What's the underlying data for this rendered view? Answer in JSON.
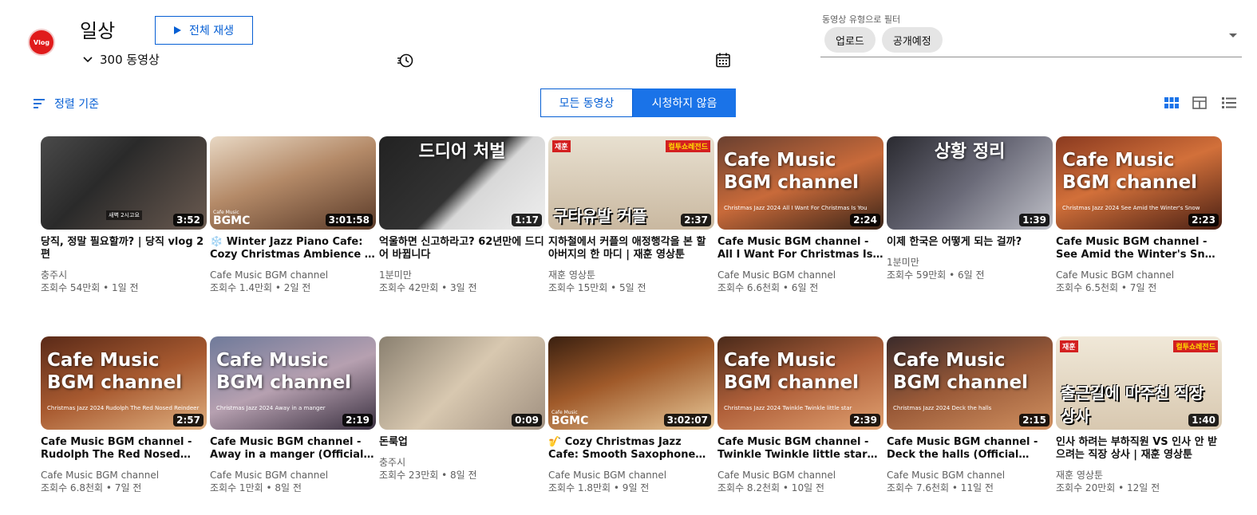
{
  "header": {
    "avatar_text": "Vlog",
    "title": "일상",
    "play_all_label": "전체 재생",
    "video_count": "300 동영상"
  },
  "filter": {
    "label": "동영상 유형으로 필터",
    "chips": [
      "업로드",
      "공개예정"
    ]
  },
  "controls": {
    "sort_label": "정렬 기준",
    "toggle_all": "모든 동영상",
    "toggle_unwatched": "시청하지 않음"
  },
  "colors": {
    "accent": "#065fd4",
    "toggle_active": "#1a73e8",
    "avatar": "#e01b1b"
  },
  "videos": [
    {
      "title": "당직, 정말 필요할까? | 당직 vlog 2편",
      "channel": "충주시",
      "meta": "조회수 54만회 • 1일 전",
      "duration": "3:52",
      "thumb": {
        "caption": "",
        "tag": "새벽 2시고요"
      }
    },
    {
      "title": "❄️ Winter Jazz Piano Cafe: Cozy Christmas Ambience | Smooth Jazz Music",
      "channel": "Cafe Music BGM channel",
      "meta": "조회수 1.4만회 • 2일 전",
      "duration": "3:01:58",
      "thumb": {
        "logo": "BGMC",
        "logo_small": "Cafe Music"
      }
    },
    {
      "title": "억울하면 신고하라고? 62년만에 드디어 바뀝니다",
      "channel": "1분미만",
      "meta": "조회수 42만회 • 3일 전",
      "duration": "1:17",
      "thumb": {
        "caption": "드디어 처벌"
      }
    },
    {
      "title": "지하철에서 커플의 애정행각을 본 할아버지의 한 마디 | 재훈 영상툰",
      "channel": "재훈 영상툰",
      "meta": "조회수 15만회 • 5일 전",
      "duration": "2:37",
      "thumb": {
        "bottom": "구타유발 커플",
        "badge_l": "재훈",
        "badge_r": "컬투쇼레전드"
      }
    },
    {
      "title": "Cafe Music BGM channel - All I Want For Christmas Is You (Official Music Video)",
      "channel": "Cafe Music BGM channel",
      "meta": "조회수 6.6천회 • 6일 전",
      "duration": "2:24",
      "thumb": {
        "caption": "Cafe Music\nBGM channel",
        "sub": "Christmas Jazz 2024  All I Want For Christmas Is You"
      }
    },
    {
      "title": "이제 한국은 어떻게 되는 걸까?",
      "channel": "1분미만",
      "meta": "조회수 59만회 • 6일 전",
      "duration": "1:39",
      "thumb": {
        "caption": "상황 정리"
      }
    },
    {
      "title": "Cafe Music BGM channel - See Amid the Winter's Snow (Official Music Video)",
      "channel": "Cafe Music BGM channel",
      "meta": "조회수 6.5천회 • 7일 전",
      "duration": "2:23",
      "thumb": {
        "caption": "Cafe Music\nBGM channel",
        "sub": "Christmas Jazz 2024  See Amid the Winter's Snow"
      }
    },
    {
      "title": "Cafe Music BGM channel - Rudolph The Red Nosed Reindeer (Official Music Video)",
      "channel": "Cafe Music BGM channel",
      "meta": "조회수 6.8천회 • 7일 전",
      "duration": "2:57",
      "thumb": {
        "caption": "Cafe Music\nBGM channel",
        "sub": "Christmas Jazz 2024  Rudolph The Red Nosed Reindeer"
      }
    },
    {
      "title": "Cafe Music BGM channel - Away in a manger (Official Music Video)",
      "channel": "Cafe Music BGM channel",
      "meta": "조회수 1만회 • 8일 전",
      "duration": "2:19",
      "thumb": {
        "caption": "Cafe Music\nBGM channel",
        "sub": "Christmas Jazz 2024  Away in a manger"
      }
    },
    {
      "title": "돈룩업",
      "channel": "충주시",
      "meta": "조회수 23만회 • 8일 전",
      "duration": "0:09",
      "thumb": {}
    },
    {
      "title": "🎷 Cozy Christmas Jazz Cafe: Smooth Saxophone Music",
      "channel": "Cafe Music BGM channel",
      "meta": "조회수 1.8만회 • 9일 전",
      "duration": "3:02:07",
      "thumb": {
        "logo": "BGMC",
        "logo_small": "Cafe Music"
      }
    },
    {
      "title": "Cafe Music BGM channel - Twinkle Twinkle little star (Official Music Video)",
      "channel": "Cafe Music BGM channel",
      "meta": "조회수 8.2천회 • 10일 전",
      "duration": "2:39",
      "thumb": {
        "caption": "Cafe Music\nBGM channel",
        "sub": "Christmas Jazz 2024  Twinkle Twinkle little star"
      }
    },
    {
      "title": "Cafe Music BGM channel - Deck the halls (Official Music Video)",
      "channel": "Cafe Music BGM channel",
      "meta": "조회수 7.6천회 • 11일 전",
      "duration": "2:15",
      "thumb": {
        "caption": "Cafe Music\nBGM channel",
        "sub": "Christmas Jazz 2024  Deck the halls"
      }
    },
    {
      "title": "인사 하려는 부하직원 VS 인사 안 받으려는 직장 상사 | 재훈 영상툰",
      "channel": "재훈 영상툰",
      "meta": "조회수 20만회 • 12일 전",
      "duration": "1:40",
      "thumb": {
        "bottom": "출근길에 마주친 직장 상사",
        "badge_l": "재훈",
        "badge_r": "컬투쇼레전드"
      }
    }
  ]
}
